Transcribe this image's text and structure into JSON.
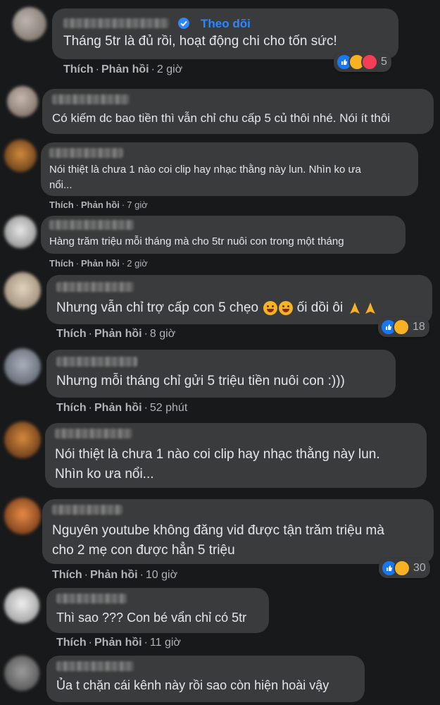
{
  "comments": [
    {
      "text": "Tháng 5tr là đủ rồi, hoạt động chi cho tốn sức!",
      "follow": "Theo dõi",
      "like": "Thích",
      "reply": "Phản hồi",
      "time": "2 giờ",
      "reactions": "5"
    },
    {
      "text": "Có kiếm dc bao tiền thì vẫn chỉ chu cấp 5 củ thôi nhé. Nói ít thôi"
    },
    {
      "line1": "Nói thiệt là chưa 1 nào coi clip hay nhạc thằng này lun. Nhìn ko ưa",
      "line2": "nổi...",
      "like": "Thích",
      "reply": "Phản hồi",
      "time": "7 giờ"
    },
    {
      "text": "Hàng trăm triệu mỗi tháng mà cho 5tr nuôi con trong một tháng",
      "like": "Thích",
      "reply": "Phản hồi",
      "time": "2 giờ"
    },
    {
      "text": "Nhưng vẫn chỉ trợ cấp con 5 chẹo",
      "text2": "ối dồi ôi",
      "like": "Thích",
      "reply": "Phản hồi",
      "time": "8 giờ",
      "reactions": "18"
    },
    {
      "text": "Nhưng mỗi tháng chỉ gửi 5 triệu tiền nuôi con :)))",
      "like": "Thích",
      "reply": "Phản hồi",
      "time": "52 phút"
    },
    {
      "line1": "Nói thiệt là chưa 1 nào coi clip hay nhạc thằng này lun.",
      "line2": "Nhìn ko ưa nổi..."
    },
    {
      "line1": "Nguyên youtube không đăng vid được tận trăm triệu mà",
      "line2": "cho 2 mẹ con được hẳn 5 triệu",
      "like": "Thích",
      "reply": "Phản hồi",
      "time": "10 giờ",
      "reactions": "30"
    },
    {
      "text": "Thì sao ??? Con bé vẩn chỉ có 5tr",
      "like": "Thích",
      "reply": "Phản hồi",
      "time": "11 giờ"
    },
    {
      "text": "Ủa t chặn cái kênh này rồi sao còn hiện hoài vậy"
    }
  ]
}
